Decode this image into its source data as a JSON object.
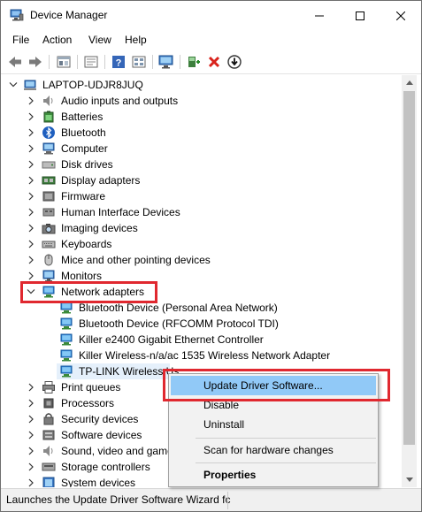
{
  "window": {
    "title": "Device Manager",
    "controls": {
      "minimize": "minimize-icon",
      "maximize": "maximize-icon",
      "close": "close-icon"
    }
  },
  "menu": [
    {
      "label": "File"
    },
    {
      "label": "Action"
    },
    {
      "label": "View"
    },
    {
      "label": "Help"
    }
  ],
  "toolbar": [
    {
      "icon": "back-arrow-icon"
    },
    {
      "icon": "forward-arrow-icon"
    },
    {
      "icon": "show-hidden-icon"
    },
    {
      "icon": "properties-sheet-icon"
    },
    {
      "icon": "help-icon"
    },
    {
      "icon": "view-icon"
    },
    {
      "icon": "monitor-scan-icon"
    },
    {
      "icon": "add-driver-icon"
    },
    {
      "icon": "uninstall-x-icon"
    },
    {
      "icon": "update-download-icon"
    }
  ],
  "tree": {
    "root": "LAPTOP-UDJR8JUQ",
    "categories": [
      {
        "label": "Audio inputs and outputs",
        "icon": "speaker-icon"
      },
      {
        "label": "Batteries",
        "icon": "battery-icon"
      },
      {
        "label": "Bluetooth",
        "icon": "bluetooth-icon"
      },
      {
        "label": "Computer",
        "icon": "computer-icon"
      },
      {
        "label": "Disk drives",
        "icon": "disk-drive-icon"
      },
      {
        "label": "Display adapters",
        "icon": "display-adapter-icon"
      },
      {
        "label": "Firmware",
        "icon": "firmware-icon"
      },
      {
        "label": "Human Interface Devices",
        "icon": "hid-icon"
      },
      {
        "label": "Imaging devices",
        "icon": "camera-icon"
      },
      {
        "label": "Keyboards",
        "icon": "keyboard-icon"
      },
      {
        "label": "Mice and other pointing devices",
        "icon": "mouse-icon"
      },
      {
        "label": "Monitors",
        "icon": "monitor-icon"
      }
    ],
    "network": {
      "label": "Network adapters",
      "icon": "network-adapter-icon",
      "children": [
        {
          "label": "Bluetooth Device (Personal Area Network)"
        },
        {
          "label": "Bluetooth Device (RFCOMM Protocol TDI)"
        },
        {
          "label": "Killer e2400 Gigabit Ethernet Controller"
        },
        {
          "label": "Killer Wireless-n/a/ac 1535 Wireless Network Adapter"
        },
        {
          "label": "TP-LINK Wireless Us"
        }
      ]
    },
    "after": [
      {
        "label": "Print queues",
        "icon": "printer-icon"
      },
      {
        "label": "Processors",
        "icon": "processor-icon"
      },
      {
        "label": "Security devices",
        "icon": "security-icon"
      },
      {
        "label": "Software devices",
        "icon": "software-icon"
      },
      {
        "label": "Sound, video and game",
        "icon": "sound-icon"
      },
      {
        "label": "Storage controllers",
        "icon": "storage-icon"
      },
      {
        "label": "System devices",
        "icon": "system-icon"
      }
    ]
  },
  "context_menu": {
    "items": [
      {
        "label": "Update Driver Software...",
        "highlighted": true
      },
      {
        "label": "Disable"
      },
      {
        "label": "Uninstall"
      },
      {
        "label": "Scan for hardware changes"
      },
      {
        "label": "Properties"
      }
    ]
  },
  "status": {
    "text": "Launches the Update Driver Software Wizard fc"
  },
  "colors": {
    "highlight_red": "#e0282f",
    "menu_hover": "#91c9f7",
    "selection": "#e5f0fb"
  }
}
